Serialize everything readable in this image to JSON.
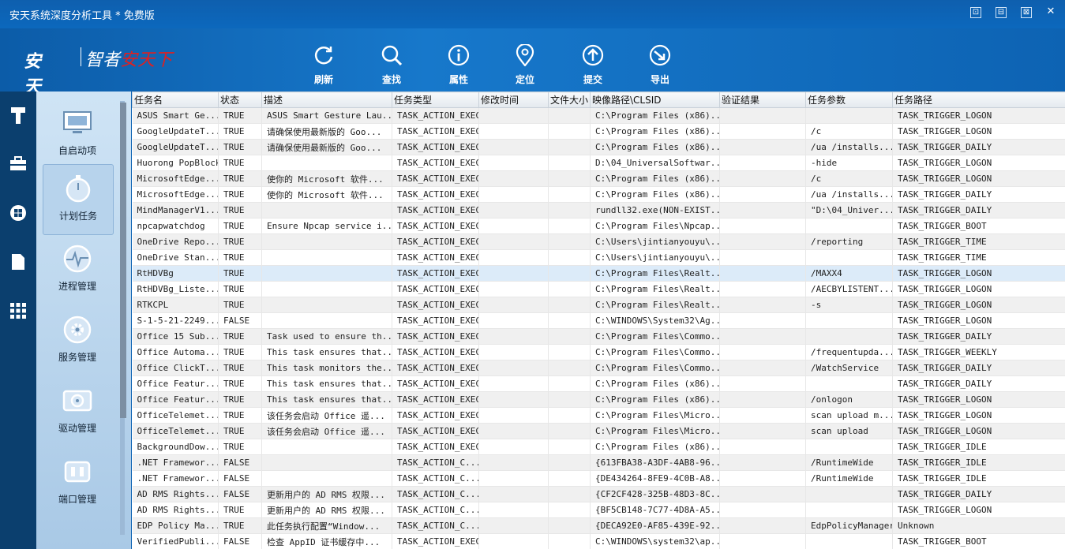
{
  "window": {
    "title": "安天系统深度分析工具 * 免费版",
    "buttons": [
      "⊡",
      "⊟",
      "⊠",
      "✕"
    ]
  },
  "logo": {
    "mark": "安天",
    "slogan_a": "智者",
    "slogan_b": "安天下"
  },
  "toolbar": [
    {
      "label": "刷新",
      "icon": "refresh-icon"
    },
    {
      "label": "查找",
      "icon": "search-icon"
    },
    {
      "label": "属性",
      "icon": "info-icon"
    },
    {
      "label": "定位",
      "icon": "location-icon"
    },
    {
      "label": "提交",
      "icon": "upload-icon"
    },
    {
      "label": "导出",
      "icon": "export-icon"
    }
  ],
  "iconbar": [
    "hammer-icon",
    "toolbox-icon",
    "windows-icon",
    "document-icon",
    "grid-icon"
  ],
  "nav": [
    {
      "label": "自启动项",
      "icon": "monitor-icon"
    },
    {
      "label": "计划任务",
      "icon": "timer-icon"
    },
    {
      "label": "进程管理",
      "icon": "pulse-icon"
    },
    {
      "label": "服务管理",
      "icon": "gear-icon"
    },
    {
      "label": "驱动管理",
      "icon": "drive-icon"
    },
    {
      "label": "端口管理",
      "icon": "port-icon"
    }
  ],
  "table": {
    "columns": [
      "任务名",
      "状态",
      "描述",
      "任务类型",
      "修改时间",
      "文件大小",
      "映像路径\\CLSID",
      "验证结果",
      "任务参数",
      "任务路径"
    ],
    "rows": [
      [
        "ASUS Smart Ge...",
        "TRUE",
        "ASUS Smart Gesture Lau...",
        "TASK_ACTION_EXEC",
        "",
        "",
        "C:\\Program Files (x86)...",
        "",
        "",
        "TASK_TRIGGER_LOGON"
      ],
      [
        "GoogleUpdateT...",
        "TRUE",
        "请确保使用最新版的 Goo...",
        "TASK_ACTION_EXEC",
        "",
        "",
        "C:\\Program Files (x86)...",
        "",
        "/c",
        "TASK_TRIGGER_LOGON"
      ],
      [
        "GoogleUpdateT...",
        "TRUE",
        "请确保使用最新版的 Goo...",
        "TASK_ACTION_EXEC",
        "",
        "",
        "C:\\Program Files (x86)...",
        "",
        "/ua /installs...",
        "TASK_TRIGGER_DAILY"
      ],
      [
        "Huorong PopBlock",
        "TRUE",
        "",
        "TASK_ACTION_EXEC",
        "",
        "",
        "D:\\04_UniversalSoftwar...",
        "",
        "-hide",
        "TASK_TRIGGER_LOGON"
      ],
      [
        "MicrosoftEdge...",
        "TRUE",
        "使你的 Microsoft 软件...",
        "TASK_ACTION_EXEC",
        "",
        "",
        "C:\\Program Files (x86)...",
        "",
        "/c",
        "TASK_TRIGGER_LOGON"
      ],
      [
        "MicrosoftEdge...",
        "TRUE",
        "使你的 Microsoft 软件...",
        "TASK_ACTION_EXEC",
        "",
        "",
        "C:\\Program Files (x86)...",
        "",
        "/ua /installs...",
        "TASK_TRIGGER_DAILY"
      ],
      [
        "MindManagerV1...",
        "TRUE",
        "",
        "TASK_ACTION_EXEC",
        "",
        "",
        "rundll32.exe(NON-EXIST...",
        "",
        "\"D:\\04_Univer...",
        "TASK_TRIGGER_DAILY"
      ],
      [
        "npcapwatchdog",
        "TRUE",
        "Ensure Npcap service i...",
        "TASK_ACTION_EXEC",
        "",
        "",
        "C:\\Program Files\\Npcap...",
        "",
        "",
        "TASK_TRIGGER_BOOT"
      ],
      [
        "OneDrive Repo...",
        "TRUE",
        "",
        "TASK_ACTION_EXEC",
        "",
        "",
        "C:\\Users\\jintianyouyu\\...",
        "",
        "/reporting",
        "TASK_TRIGGER_TIME"
      ],
      [
        "OneDrive Stan...",
        "TRUE",
        "",
        "TASK_ACTION_EXEC",
        "",
        "",
        "C:\\Users\\jintianyouyu\\...",
        "",
        "",
        "TASK_TRIGGER_TIME"
      ],
      [
        "RtHDVBg",
        "TRUE",
        "",
        "TASK_ACTION_EXEC",
        "",
        "",
        "C:\\Program Files\\Realt...",
        "",
        "/MAXX4",
        "TASK_TRIGGER_LOGON"
      ],
      [
        "RtHDVBg_Liste...",
        "TRUE",
        "",
        "TASK_ACTION_EXEC",
        "",
        "",
        "C:\\Program Files\\Realt...",
        "",
        "/AECBYLISTENT...",
        "TASK_TRIGGER_LOGON"
      ],
      [
        "RTKCPL",
        "TRUE",
        "",
        "TASK_ACTION_EXEC",
        "",
        "",
        "C:\\Program Files\\Realt...",
        "",
        "-s",
        "TASK_TRIGGER_LOGON"
      ],
      [
        "S-1-5-21-2249...",
        "FALSE",
        "",
        "TASK_ACTION_EXEC",
        "",
        "",
        "C:\\WINDOWS\\System32\\Ag...",
        "",
        "",
        "TASK_TRIGGER_LOGON"
      ],
      [
        "Office 15 Sub...",
        "TRUE",
        "Task used to ensure th...",
        "TASK_ACTION_EXEC",
        "",
        "",
        "C:\\Program Files\\Commo...",
        "",
        "",
        "TASK_TRIGGER_DAILY"
      ],
      [
        "Office Automa...",
        "TRUE",
        "This task ensures that...",
        "TASK_ACTION_EXEC",
        "",
        "",
        "C:\\Program Files\\Commo...",
        "",
        "/frequentupda...",
        "TASK_TRIGGER_WEEKLY"
      ],
      [
        "Office ClickT...",
        "TRUE",
        "This task monitors the...",
        "TASK_ACTION_EXEC",
        "",
        "",
        "C:\\Program Files\\Commo...",
        "",
        "/WatchService",
        "TASK_TRIGGER_DAILY"
      ],
      [
        "Office Featur...",
        "TRUE",
        "This task ensures that...",
        "TASK_ACTION_EXEC",
        "",
        "",
        "C:\\Program Files (x86)...",
        "",
        "",
        "TASK_TRIGGER_DAILY"
      ],
      [
        "Office Featur...",
        "TRUE",
        "This task ensures that...",
        "TASK_ACTION_EXEC",
        "",
        "",
        "C:\\Program Files (x86)...",
        "",
        "/onlogon",
        "TASK_TRIGGER_LOGON"
      ],
      [
        "OfficeTelemet...",
        "TRUE",
        "该任务会启动 Office 遥...",
        "TASK_ACTION_EXEC",
        "",
        "",
        "C:\\Program Files\\Micro...",
        "",
        "scan upload m...",
        "TASK_TRIGGER_LOGON"
      ],
      [
        "OfficeTelemet...",
        "TRUE",
        "该任务会启动 Office 遥...",
        "TASK_ACTION_EXEC",
        "",
        "",
        "C:\\Program Files\\Micro...",
        "",
        "scan upload",
        "TASK_TRIGGER_LOGON"
      ],
      [
        "BackgroundDow...",
        "TRUE",
        "",
        "TASK_ACTION_EXEC",
        "",
        "",
        "C:\\Program Files (x86)...",
        "",
        "",
        "TASK_TRIGGER_IDLE"
      ],
      [
        ".NET Framewor...",
        "FALSE",
        "",
        "TASK_ACTION_C...",
        "",
        "",
        "{613FBA38-A3DF-4AB8-96...",
        "",
        "/RuntimeWide",
        "TASK_TRIGGER_IDLE"
      ],
      [
        ".NET Framewor...",
        "FALSE",
        "",
        "TASK_ACTION_C...",
        "",
        "",
        "{DE434264-8FE9-4C0B-A8...",
        "",
        "/RuntimeWide",
        "TASK_TRIGGER_IDLE"
      ],
      [
        "AD RMS Rights...",
        "FALSE",
        "更新用户的 AD RMS 权限...",
        "TASK_ACTION_C...",
        "",
        "",
        "{CF2CF428-325B-48D3-8C...",
        "",
        "",
        "TASK_TRIGGER_DAILY"
      ],
      [
        "AD RMS Rights...",
        "TRUE",
        "更新用户的 AD RMS 权限...",
        "TASK_ACTION_C...",
        "",
        "",
        "{BF5CB148-7C77-4D8A-A5...",
        "",
        "",
        "TASK_TRIGGER_LOGON"
      ],
      [
        "EDP Policy Ma...",
        "TRUE",
        "此任务执行配置“Window...",
        "TASK_ACTION_C...",
        "",
        "",
        "{DECA92E0-AF85-439E-92...",
        "",
        "EdpPolicyManager",
        "Unknown"
      ],
      [
        "VerifiedPubli...",
        "FALSE",
        "检查 AppID 证书缓存中...",
        "TASK_ACTION_EXEC",
        "",
        "",
        "C:\\WINDOWS\\system32\\ap...",
        "",
        "",
        "TASK_TRIGGER_BOOT"
      ]
    ]
  }
}
